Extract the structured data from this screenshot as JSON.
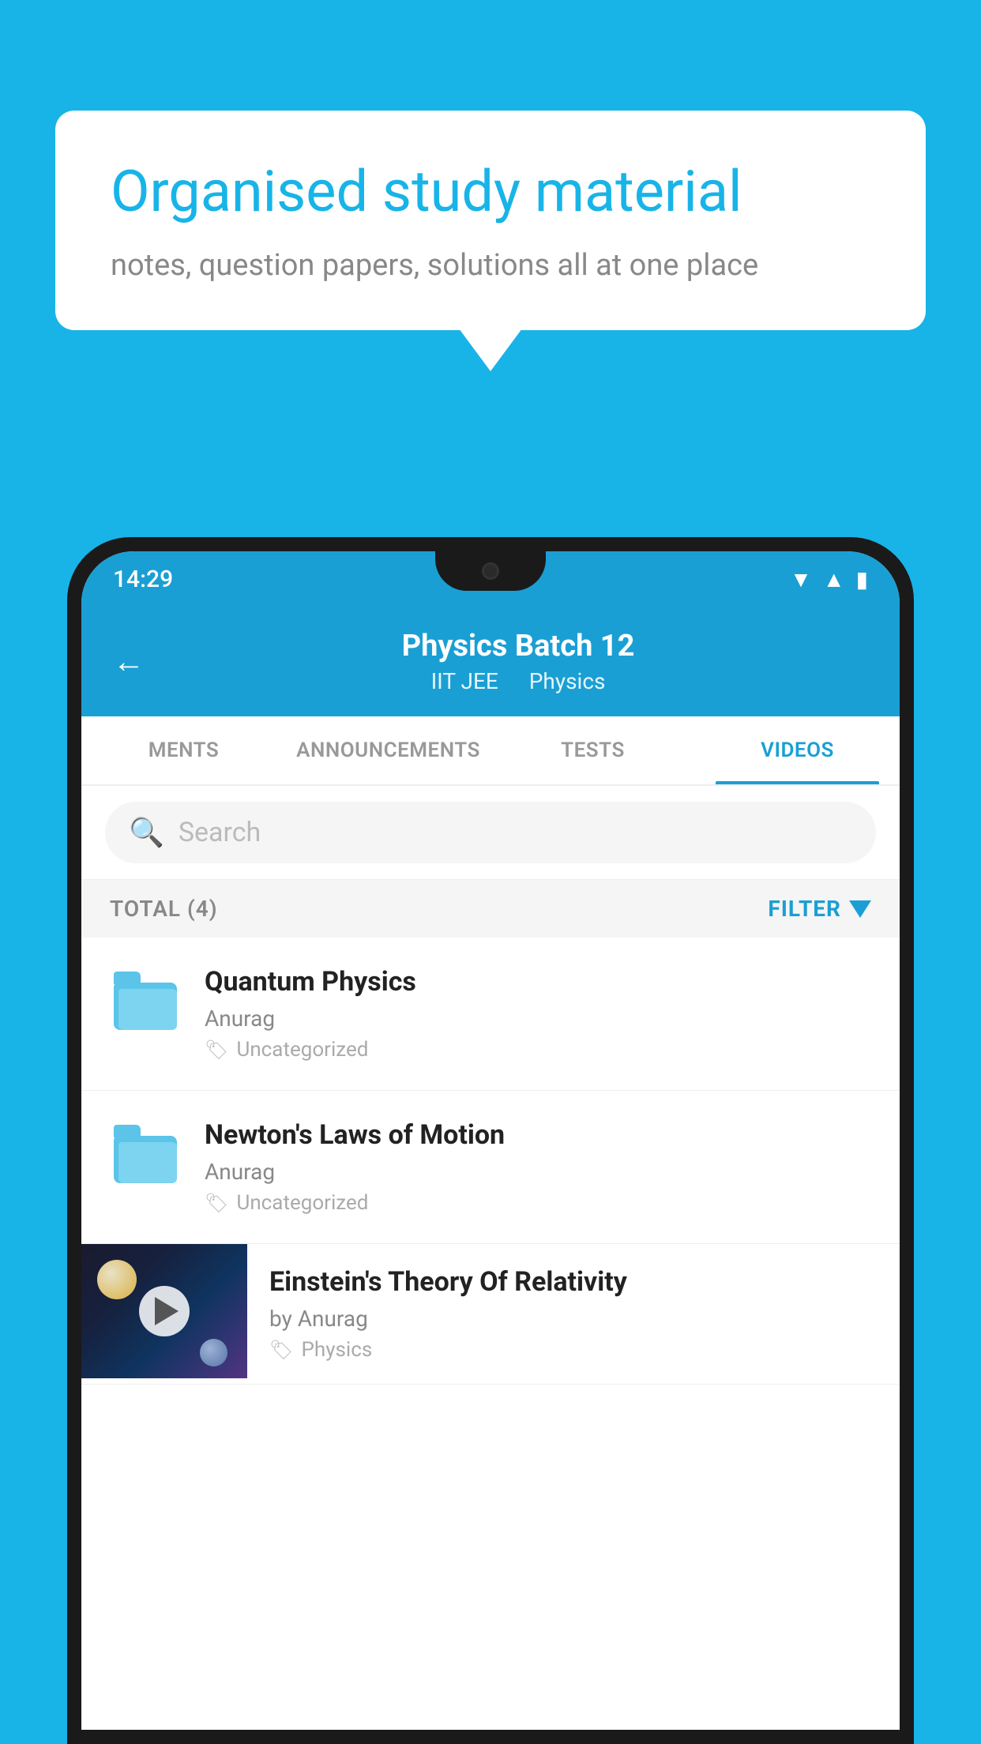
{
  "background": {
    "color": "#18b4e8"
  },
  "speech_bubble": {
    "title": "Organised study material",
    "subtitle": "notes, question papers, solutions all at one place"
  },
  "status_bar": {
    "time": "14:29"
  },
  "app_header": {
    "title": "Physics Batch 12",
    "subtitle_part1": "IIT JEE",
    "subtitle_part2": "Physics",
    "back_label": "←"
  },
  "tabs": [
    {
      "label": "MENTS",
      "active": false
    },
    {
      "label": "ANNOUNCEMENTS",
      "active": false
    },
    {
      "label": "TESTS",
      "active": false
    },
    {
      "label": "VIDEOS",
      "active": true
    }
  ],
  "search": {
    "placeholder": "Search"
  },
  "filter_bar": {
    "total_label": "TOTAL (4)",
    "filter_label": "FILTER"
  },
  "videos": [
    {
      "title": "Quantum Physics",
      "author": "Anurag",
      "tag": "Uncategorized",
      "type": "folder"
    },
    {
      "title": "Newton's Laws of Motion",
      "author": "Anurag",
      "tag": "Uncategorized",
      "type": "folder"
    },
    {
      "title": "Einstein's Theory Of Relativity",
      "author": "by Anurag",
      "tag": "Physics",
      "type": "video"
    }
  ]
}
